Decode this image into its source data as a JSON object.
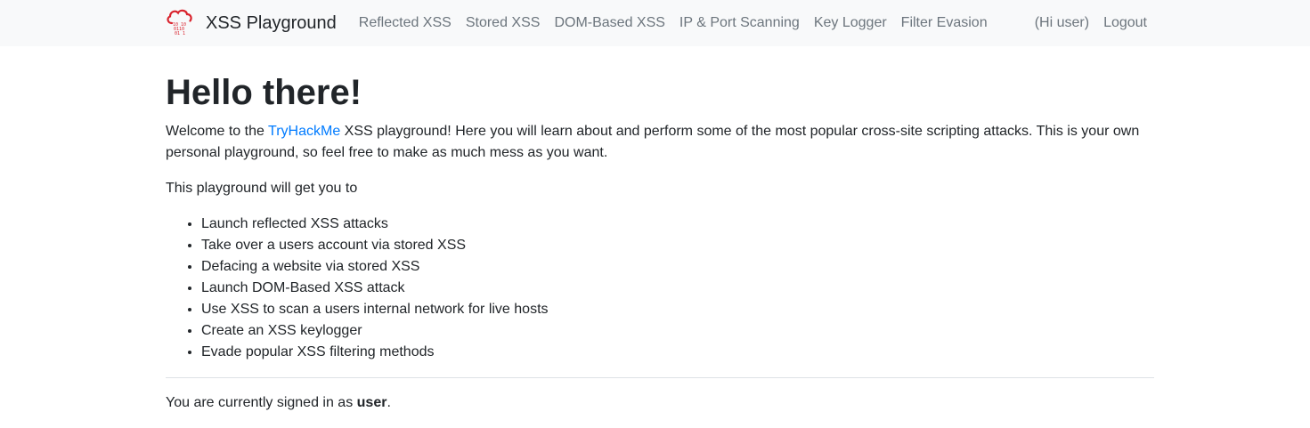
{
  "navbar": {
    "brand": "XSS Playground",
    "links": [
      "Reflected XSS",
      "Stored XSS",
      "DOM-Based XSS",
      "IP & Port Scanning",
      "Key Logger",
      "Filter Evasion"
    ],
    "greeting": "(Hi user)",
    "logout": "Logout",
    "logo_icon": "cloud-binary-icon",
    "logo_color": "#d9232d"
  },
  "main": {
    "heading": "Hello there!",
    "intro": {
      "before": "Welcome to the ",
      "link": "TryHackMe",
      "after": " XSS playground! Here you will learn about and perform some of the most popular cross-site scripting attacks. This is your own personal playground, so feel free to make as much mess as you want."
    },
    "lead": "This playground will get you to",
    "features": [
      "Launch reflected XSS attacks",
      "Take over a users account via stored XSS",
      "Defacing a website via stored XSS",
      "Launch DOM-Based XSS attack",
      "Use XSS to scan a users internal network for live hosts",
      "Create an XSS keylogger",
      "Evade popular XSS filtering methods"
    ],
    "signed_in": {
      "before": "You are currently signed in as ",
      "user": "user",
      "after": "."
    }
  },
  "colors": {
    "link": "#007bff",
    "navbar_bg": "#f8f9fa",
    "nav_text": "#6c757d"
  }
}
